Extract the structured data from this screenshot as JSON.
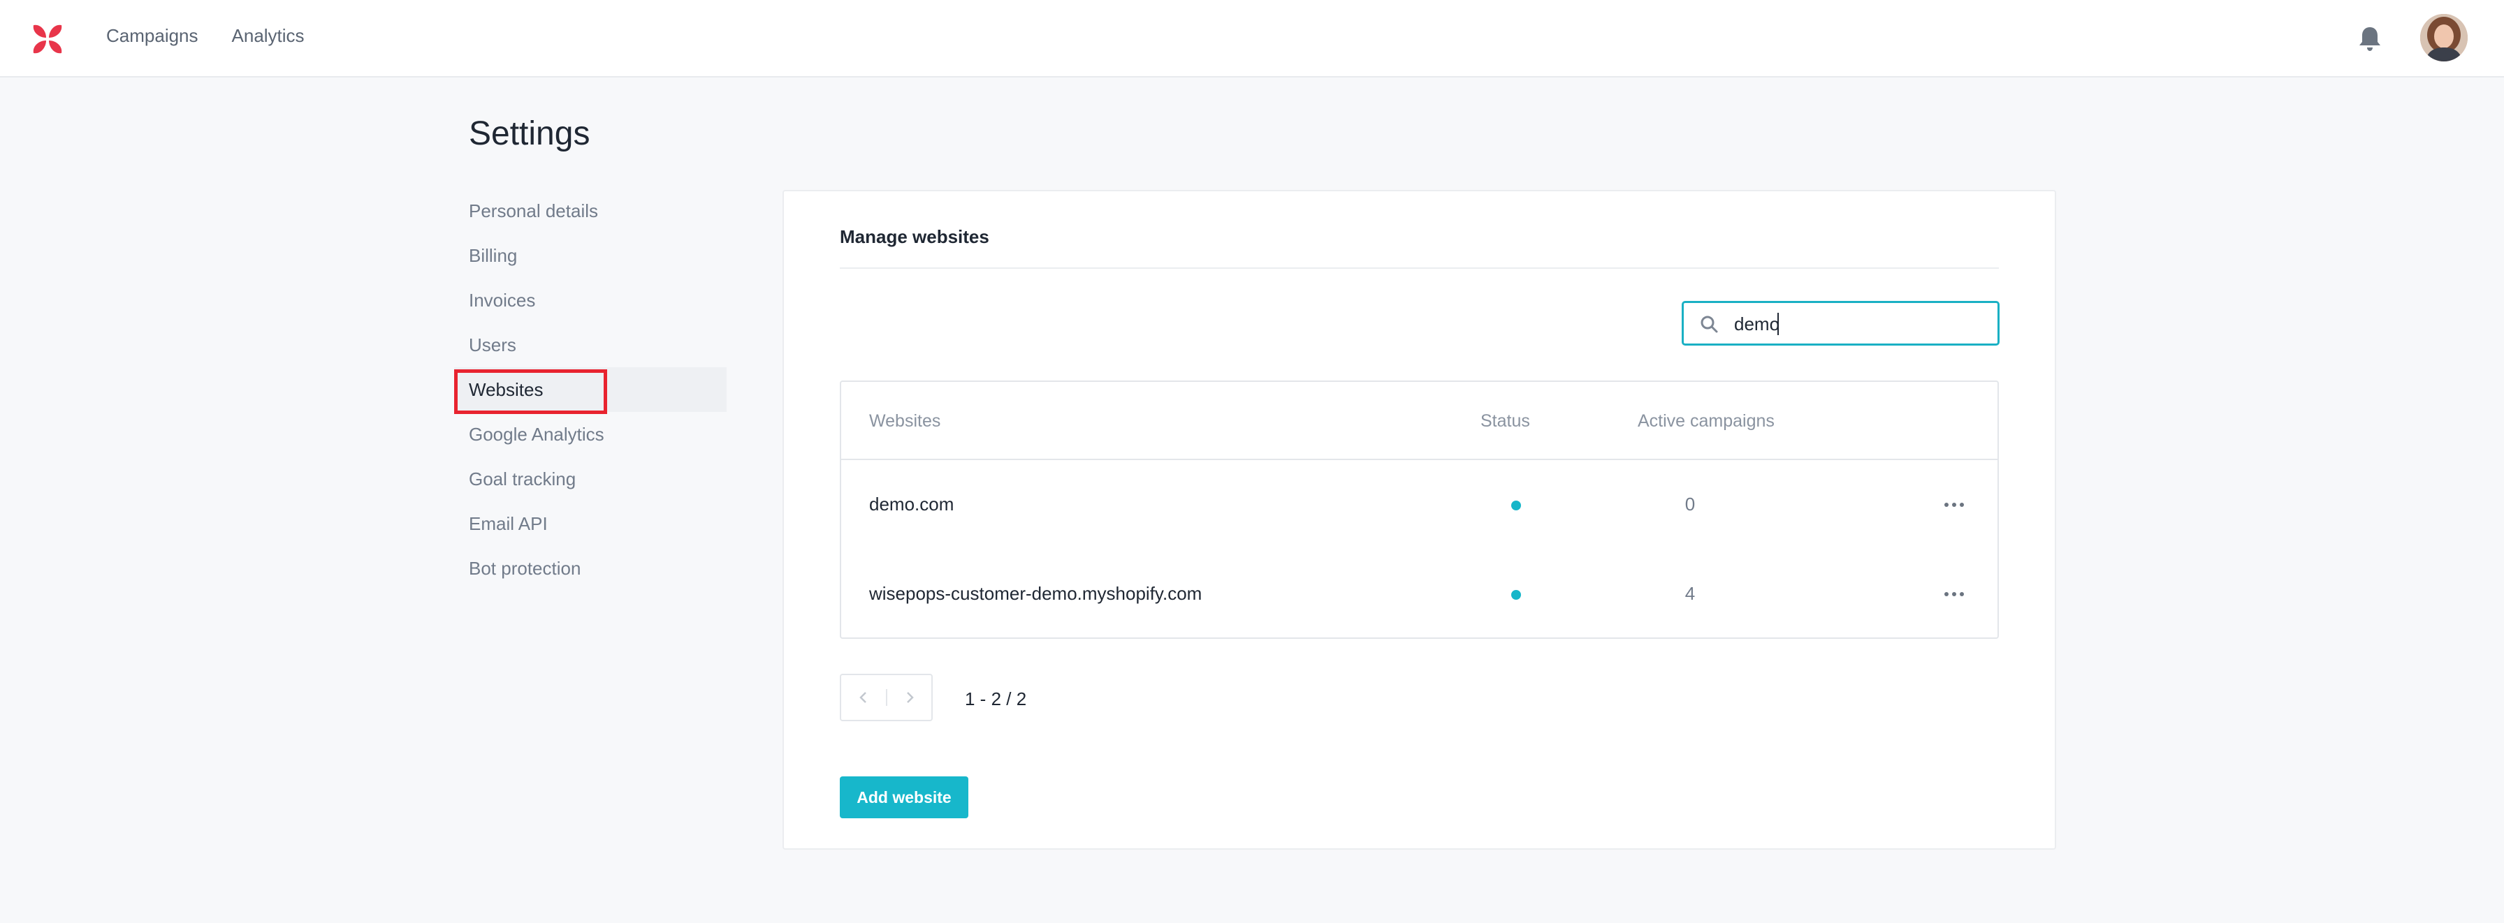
{
  "app": {
    "nav": [
      {
        "label": "Campaigns"
      },
      {
        "label": "Analytics"
      }
    ],
    "icons": {
      "logo": "wisepops-x-logo-icon",
      "notifications": "bell-icon",
      "avatar": "user-avatar"
    },
    "brand_color": "#e8354a",
    "accent_color": "#17b7cb"
  },
  "settings": {
    "title": "Settings",
    "menu": [
      {
        "label": "Personal details",
        "active": false
      },
      {
        "label": "Billing",
        "active": false
      },
      {
        "label": "Invoices",
        "active": false
      },
      {
        "label": "Users",
        "active": false
      },
      {
        "label": "Websites",
        "active": true
      },
      {
        "label": "Google Analytics",
        "active": false
      },
      {
        "label": "Goal tracking",
        "active": false
      },
      {
        "label": "Email API",
        "active": false
      },
      {
        "label": "Bot protection",
        "active": false
      }
    ]
  },
  "websites": {
    "title": "Manage websites",
    "search": {
      "value": "demo",
      "icon": "search-icon"
    },
    "columns": {
      "website": "Websites",
      "status": "Status",
      "active_campaigns": "Active campaigns"
    },
    "rows": [
      {
        "website": "demo.com",
        "status": "active",
        "active_campaigns": "0"
      },
      {
        "website": "wisepops-customer-demo.myshopify.com",
        "status": "active",
        "active_campaigns": "4"
      }
    ],
    "pagination": {
      "info": "1 - 2 / 2"
    },
    "add_button": "Add website"
  }
}
